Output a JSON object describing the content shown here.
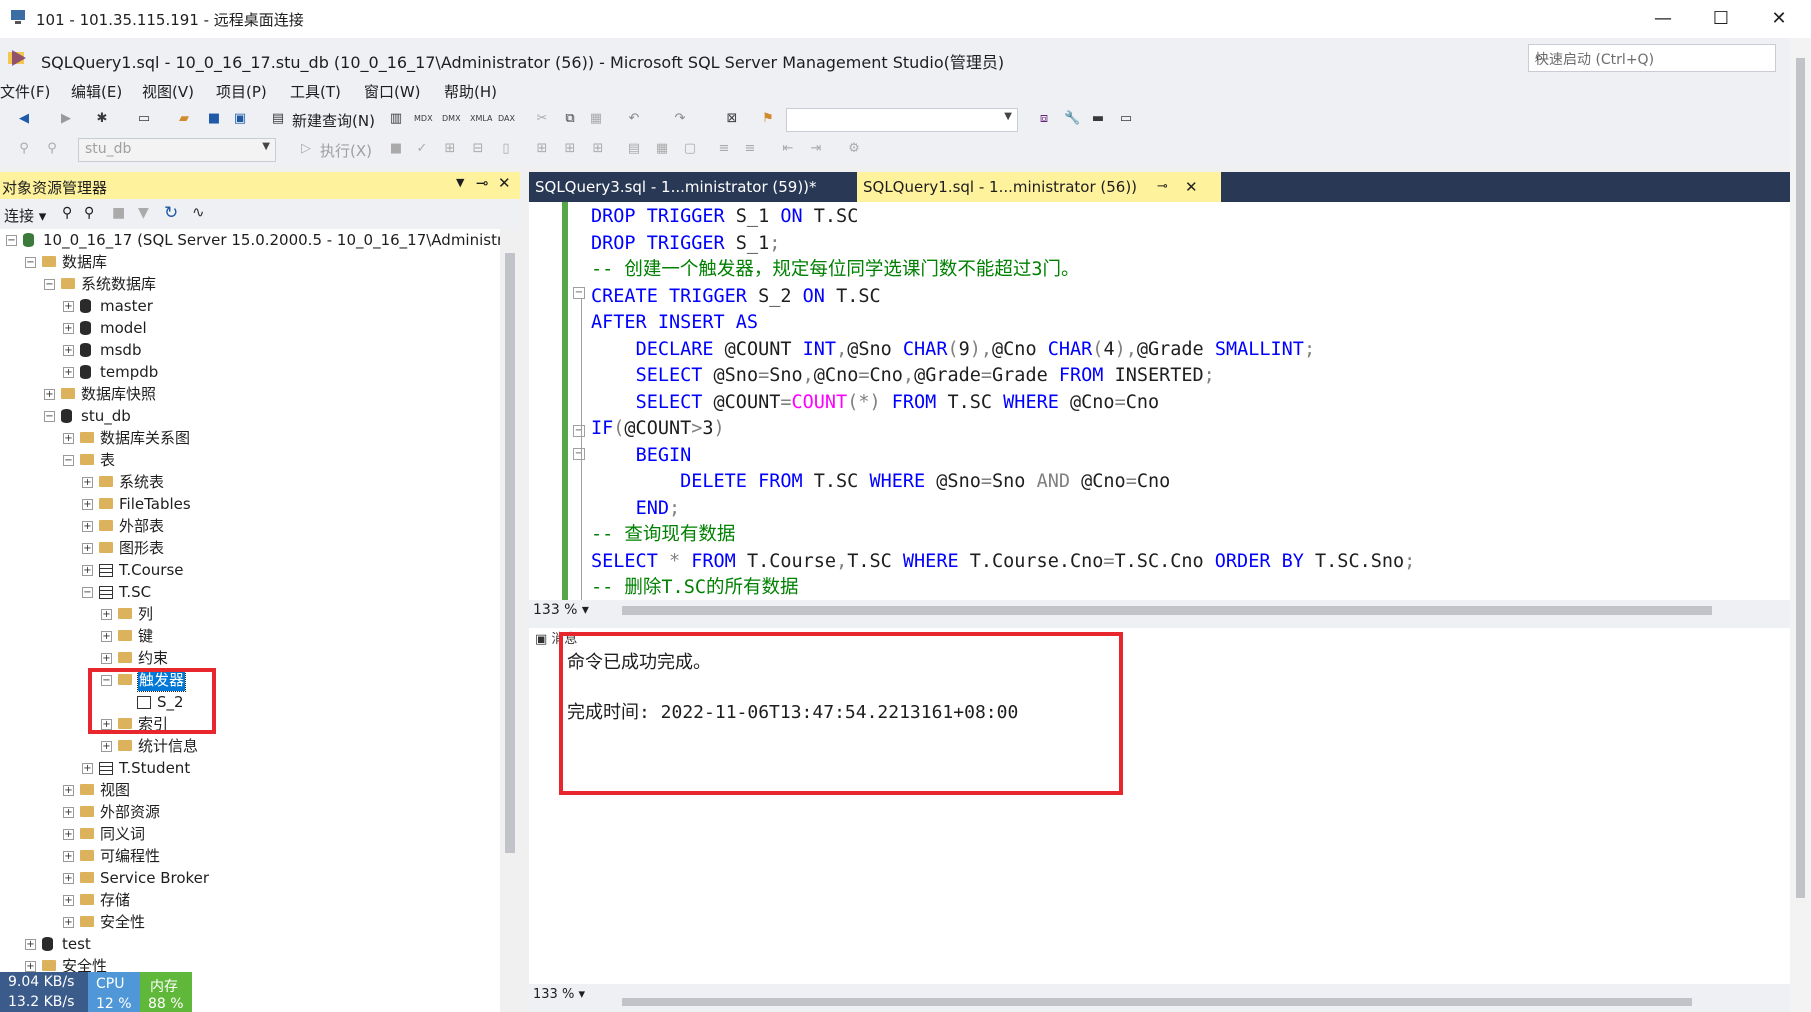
{
  "rdp": {
    "title": "101 - 101.35.115.191 - 远程桌面连接",
    "minimize": "—",
    "maximize": "☐",
    "close": "✕"
  },
  "ssms": {
    "title": "SQLQuery1.sql - 10_0_16_17.stu_db (10_0_16_17\\Administrator (56)) - Microsoft SQL Server Management Studio(管理员)",
    "quick_launch_placeholder": "快速启动 (Ctrl+Q)"
  },
  "menu": [
    "文件(F)",
    "编辑(E)",
    "视图(V)",
    "项目(P)",
    "工具(T)",
    "窗口(W)",
    "帮助(H)"
  ],
  "toolbar1": {
    "new_query": "新建查询(N)",
    "icon_labels": [
      "MDX",
      "DMX",
      "XMLA",
      "DAX"
    ]
  },
  "toolbar2": {
    "database": "stu_db",
    "execute": "执行(X)"
  },
  "object_explorer": {
    "title": "对象资源管理器",
    "connect": "连接",
    "tree": [
      {
        "label": "10_0_16_17 (SQL Server 15.0.2000.5 - 10_0_16_17\\Administrator)",
        "icon": "server-icon",
        "exp": "−"
      },
      {
        "label": "数据库",
        "icon": "folder-icon",
        "exp": "−"
      },
      {
        "label": "系统数据库",
        "icon": "folder-icon",
        "exp": "−"
      },
      {
        "label": "master",
        "icon": "database-icon",
        "exp": "+"
      },
      {
        "label": "model",
        "icon": "database-icon",
        "exp": "+"
      },
      {
        "label": "msdb",
        "icon": "database-icon",
        "exp": "+"
      },
      {
        "label": "tempdb",
        "icon": "database-icon",
        "exp": "+"
      },
      {
        "label": "数据库快照",
        "icon": "folder-icon",
        "exp": "+"
      },
      {
        "label": "stu_db",
        "icon": "database-icon",
        "exp": "−"
      },
      {
        "label": "数据库关系图",
        "icon": "folder-icon",
        "exp": "+"
      },
      {
        "label": "表",
        "icon": "folder-icon",
        "exp": "−"
      },
      {
        "label": "系统表",
        "icon": "folder-icon",
        "exp": "+"
      },
      {
        "label": "FileTables",
        "icon": "folder-icon",
        "exp": "+"
      },
      {
        "label": "外部表",
        "icon": "folder-icon",
        "exp": "+"
      },
      {
        "label": "图形表",
        "icon": "folder-icon",
        "exp": "+"
      },
      {
        "label": "T.Course",
        "icon": "table-icon",
        "exp": "+"
      },
      {
        "label": "T.SC",
        "icon": "table-icon",
        "exp": "−"
      },
      {
        "label": "列",
        "icon": "folder-icon",
        "exp": "+"
      },
      {
        "label": "键",
        "icon": "folder-icon",
        "exp": "+"
      },
      {
        "label": "约束",
        "icon": "folder-icon",
        "exp": "+"
      },
      {
        "label": "触发器",
        "icon": "folder-icon",
        "exp": "−"
      },
      {
        "label": "S_2",
        "icon": "trigger-icon",
        "exp": ""
      },
      {
        "label": "索引",
        "icon": "folder-icon",
        "exp": "+"
      },
      {
        "label": "统计信息",
        "icon": "folder-icon",
        "exp": "+"
      },
      {
        "label": "T.Student",
        "icon": "table-icon",
        "exp": "+"
      },
      {
        "label": "视图",
        "icon": "folder-icon",
        "exp": "+"
      },
      {
        "label": "外部资源",
        "icon": "folder-icon",
        "exp": "+"
      },
      {
        "label": "同义词",
        "icon": "folder-icon",
        "exp": "+"
      },
      {
        "label": "可编程性",
        "icon": "folder-icon",
        "exp": "+"
      },
      {
        "label": "Service Broker",
        "icon": "folder-icon",
        "exp": "+"
      },
      {
        "label": "存储",
        "icon": "folder-icon",
        "exp": "+"
      },
      {
        "label": "安全性",
        "icon": "folder-icon",
        "exp": "+"
      },
      {
        "label": "test",
        "icon": "database-icon",
        "exp": "+"
      },
      {
        "label": "安全性",
        "icon": "folder-icon",
        "exp": "+"
      }
    ],
    "selected": "触发器"
  },
  "tabs": [
    {
      "label": "SQLQuery3.sql - 1...ministrator (59))*"
    },
    {
      "label": "SQLQuery1.sql - 1...ministrator (56))"
    }
  ],
  "tab_pin": "⊸",
  "tab_close": "✕",
  "editor": {
    "lines": [
      [
        [
          "kw",
          "DROP TRIGGER "
        ],
        [
          "id",
          "S_1 "
        ],
        [
          "kw",
          "ON "
        ],
        [
          "id",
          "T.SC"
        ]
      ],
      [
        [
          "kw",
          "DROP TRIGGER "
        ],
        [
          "id",
          "S_1"
        ],
        [
          "gy",
          ";"
        ]
      ],
      [
        [
          "cm",
          "-- 创建一个触发器，规定每位同学选课门数不能超过3门。"
        ]
      ],
      [
        [
          "kw",
          "CREATE TRIGGER "
        ],
        [
          "id",
          "S_2 "
        ],
        [
          "kw",
          "ON "
        ],
        [
          "id",
          "T.SC"
        ]
      ],
      [
        [
          "kw",
          "AFTER INSERT AS"
        ]
      ],
      [
        [
          "id",
          "    "
        ],
        [
          "kw",
          "DECLARE "
        ],
        [
          "id",
          "@COUNT "
        ],
        [
          "kw",
          "INT"
        ],
        [
          "gy",
          ","
        ],
        [
          "id",
          "@Sno "
        ],
        [
          "kw",
          "CHAR"
        ],
        [
          "gy",
          "("
        ],
        [
          "id",
          "9"
        ],
        [
          "gy",
          "),"
        ],
        [
          "id",
          "@Cno "
        ],
        [
          "kw",
          "CHAR"
        ],
        [
          "gy",
          "("
        ],
        [
          "id",
          "4"
        ],
        [
          "gy",
          "),"
        ],
        [
          "id",
          "@Grade "
        ],
        [
          "kw",
          "SMALLINT"
        ],
        [
          "gy",
          ";"
        ]
      ],
      [
        [
          "id",
          "    "
        ],
        [
          "kw",
          "SELECT "
        ],
        [
          "id",
          "@Sno"
        ],
        [
          "gy",
          "="
        ],
        [
          "id",
          "Sno"
        ],
        [
          "gy",
          ","
        ],
        [
          "id",
          "@Cno"
        ],
        [
          "gy",
          "="
        ],
        [
          "id",
          "Cno"
        ],
        [
          "gy",
          ","
        ],
        [
          "id",
          "@Grade"
        ],
        [
          "gy",
          "="
        ],
        [
          "id",
          "Grade "
        ],
        [
          "kw",
          "FROM "
        ],
        [
          "id",
          "INSERTED"
        ],
        [
          "gy",
          ";"
        ]
      ],
      [
        [
          "id",
          "    "
        ],
        [
          "kw",
          "SELECT "
        ],
        [
          "id",
          "@COUNT"
        ],
        [
          "gy",
          "="
        ],
        [
          "fn",
          "COUNT"
        ],
        [
          "gy",
          "(*) "
        ],
        [
          "kw",
          "FROM "
        ],
        [
          "id",
          "T.SC "
        ],
        [
          "kw",
          "WHERE "
        ],
        [
          "id",
          "@Cno"
        ],
        [
          "gy",
          "="
        ],
        [
          "id",
          "Cno"
        ]
      ],
      [
        [
          "kw",
          "IF"
        ],
        [
          "gy",
          "("
        ],
        [
          "id",
          "@COUNT"
        ],
        [
          "gy",
          ">"
        ],
        [
          "id",
          "3"
        ],
        [
          "gy",
          ")"
        ]
      ],
      [
        [
          "id",
          "    "
        ],
        [
          "kw",
          "BEGIN"
        ]
      ],
      [
        [
          "id",
          "        "
        ],
        [
          "kw",
          "DELETE FROM "
        ],
        [
          "id",
          "T.SC "
        ],
        [
          "kw",
          "WHERE "
        ],
        [
          "id",
          "@Sno"
        ],
        [
          "gy",
          "="
        ],
        [
          "id",
          "Sno "
        ],
        [
          "gy",
          "AND "
        ],
        [
          "id",
          "@Cno"
        ],
        [
          "gy",
          "="
        ],
        [
          "id",
          "Cno"
        ]
      ],
      [
        [
          "id",
          "    "
        ],
        [
          "kw",
          "END"
        ],
        [
          "gy",
          ";"
        ]
      ],
      [
        [
          "cm",
          "-- 查询现有数据"
        ]
      ],
      [
        [
          "kw",
          "SELECT "
        ],
        [
          "gy",
          "* "
        ],
        [
          "kw",
          "FROM "
        ],
        [
          "id",
          "T.Course"
        ],
        [
          "gy",
          ","
        ],
        [
          "id",
          "T.SC "
        ],
        [
          "kw",
          "WHERE "
        ],
        [
          "id",
          "T.Course.Cno"
        ],
        [
          "gy",
          "="
        ],
        [
          "id",
          "T.SC.Cno "
        ],
        [
          "kw",
          "ORDER BY "
        ],
        [
          "id",
          "T.SC.Sno"
        ],
        [
          "gy",
          ";"
        ]
      ],
      [
        [
          "cm",
          "-- 删除T.SC的所有数据"
        ]
      ]
    ],
    "zoom": "133 %"
  },
  "results": {
    "tab_label": "消息",
    "message": "命令已成功完成。",
    "completion": "完成时间: 2022-11-06T13:47:54.2213161+08:00",
    "zoom": "133 %"
  },
  "netmon": {
    "up": "9.04 KB/s",
    "down": "13.2 KB/s",
    "cpu_label": "CPU",
    "cpu_value": "12 %",
    "mem_label": "内存",
    "mem_value": "88 %"
  },
  "colors": {
    "accent_tab": "#fff29d",
    "tab_strip": "#293955",
    "highlight_box": "#e8262d"
  }
}
